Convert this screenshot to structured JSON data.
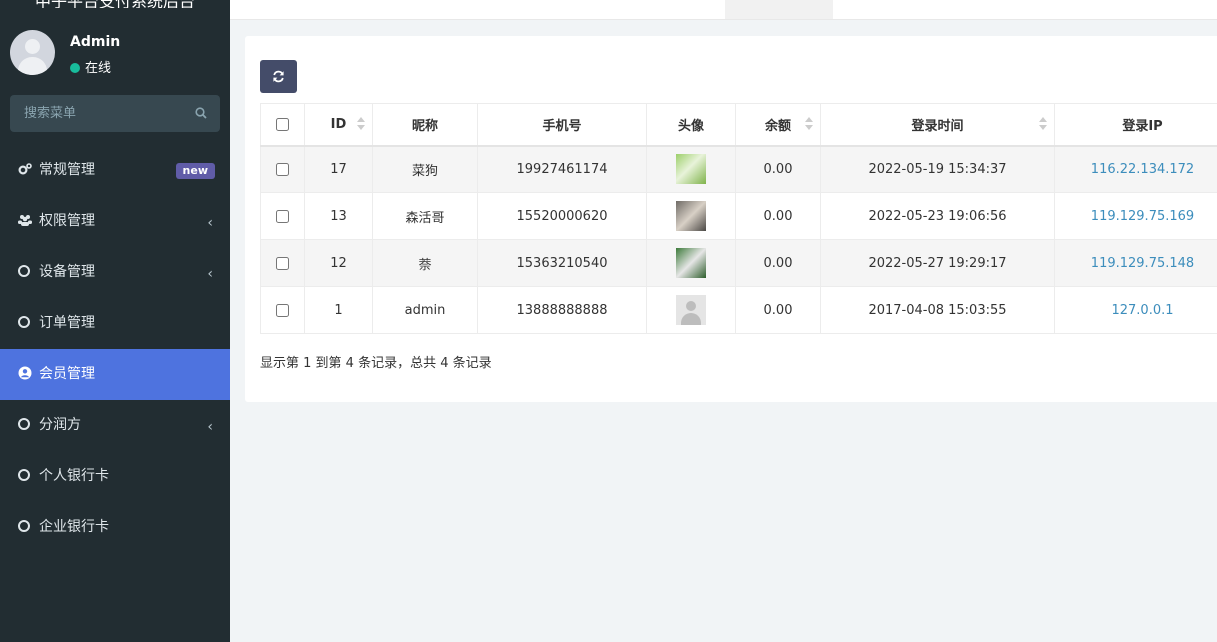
{
  "sidebar": {
    "brand": "中子平台支付系统后台",
    "user": {
      "name": "Admin",
      "status": "在线"
    },
    "search_placeholder": "搜索菜单",
    "items": [
      {
        "label": "常规管理",
        "icon": "cogs-icon",
        "badge": "new"
      },
      {
        "label": "权限管理",
        "icon": "users-icon",
        "chevron": "‹"
      },
      {
        "label": "设备管理",
        "icon": "circle-icon",
        "chevron": "‹"
      },
      {
        "label": "订单管理",
        "icon": "circle-icon"
      },
      {
        "label": "会员管理",
        "icon": "user-circle-icon",
        "active": true
      },
      {
        "label": "分润方",
        "icon": "circle-icon",
        "chevron": "‹"
      },
      {
        "label": "个人银行卡",
        "icon": "circle-icon"
      },
      {
        "label": "企业银行卡",
        "icon": "circle-icon"
      }
    ]
  },
  "table": {
    "columns": [
      "ID",
      "昵称",
      "手机号",
      "头像",
      "余额",
      "登录时间",
      "登录IP"
    ],
    "rows": [
      {
        "id": "17",
        "nickname": "菜狗",
        "phone": "19927461174",
        "balance": "0.00",
        "login_time": "2022-05-19 15:34:37",
        "login_ip": "116.22.134.172"
      },
      {
        "id": "13",
        "nickname": "森活哥",
        "phone": "15520000620",
        "balance": "0.00",
        "login_time": "2022-05-23 19:06:56",
        "login_ip": "119.129.75.169"
      },
      {
        "id": "12",
        "nickname": "萘",
        "phone": "15363210540",
        "balance": "0.00",
        "login_time": "2022-05-27 19:29:17",
        "login_ip": "119.129.75.148"
      },
      {
        "id": "1",
        "nickname": "admin",
        "phone": "13888888888",
        "balance": "0.00",
        "login_time": "2017-04-08 15:03:55",
        "login_ip": "127.0.0.1"
      }
    ]
  },
  "pagination": {
    "summary": "显示第 1 到第 4 条记录，总共 4 条记录"
  },
  "colors": {
    "sidebar_bg": "#222d32",
    "active_menu": "#4e73df",
    "link": "#3c8dbc",
    "online": "#18bc9c",
    "badge": "#605ca8"
  }
}
